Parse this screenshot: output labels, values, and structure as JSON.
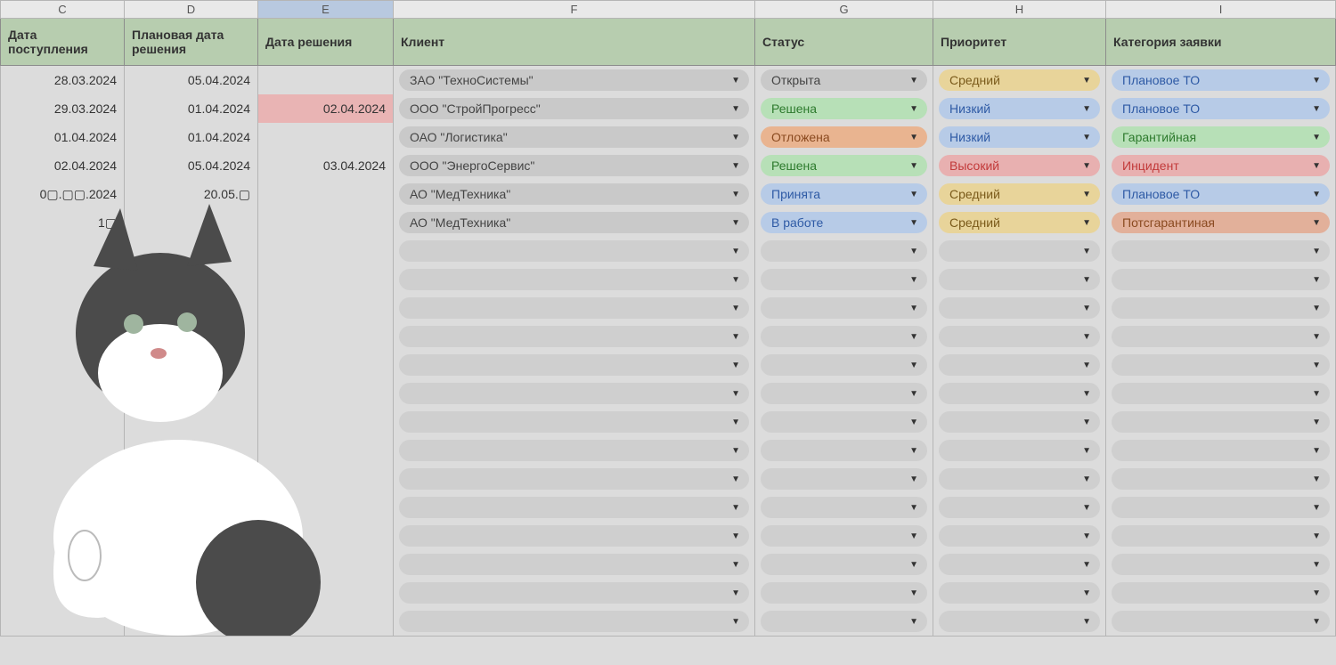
{
  "columns": [
    {
      "letter": "C",
      "header": "Дата поступления",
      "selected": false
    },
    {
      "letter": "D",
      "header": "Плановая дата решения",
      "selected": false
    },
    {
      "letter": "E",
      "header": "Дата решения",
      "selected": true
    },
    {
      "letter": "F",
      "header": "Клиент",
      "selected": false
    },
    {
      "letter": "G",
      "header": "Статус",
      "selected": false
    },
    {
      "letter": "H",
      "header": "Приоритет",
      "selected": false
    },
    {
      "letter": "I",
      "header": "Категория заявки",
      "selected": false
    }
  ],
  "status_colors": {
    "Открыта": "pill-gray",
    "Решена": "pill-green",
    "Отложена": "pill-orange",
    "Принята": "pill-blue",
    "В работе": "pill-blue"
  },
  "priority_colors": {
    "Средний": "pill-yellow",
    "Низкий": "pill-blue",
    "Высокий": "pill-red"
  },
  "category_colors": {
    "Плановое ТО": "pill-blue",
    "Гарантийная": "pill-green",
    "Инцидент": "pill-red",
    "Потсгарантиная": "pill-brown"
  },
  "rows": [
    {
      "date_in": "28.03.2024",
      "date_plan": "05.04.2024",
      "date_res": "",
      "res_late": false,
      "client": "ЗАО \"ТехноСистемы\"",
      "status": "Открыта",
      "priority": "Средний",
      "category": "Плановое ТО"
    },
    {
      "date_in": "29.03.2024",
      "date_plan": "01.04.2024",
      "date_res": "02.04.2024",
      "res_late": true,
      "client": "ООО \"СтройПрогресс\"",
      "status": "Решена",
      "priority": "Низкий",
      "category": "Плановое ТО"
    },
    {
      "date_in": "01.04.2024",
      "date_plan": "01.04.2024",
      "date_res": "",
      "res_late": false,
      "client": "ОАО \"Логистика\"",
      "status": "Отложена",
      "priority": "Низкий",
      "category": "Гарантийная"
    },
    {
      "date_in": "02.04.2024",
      "date_plan": "05.04.2024",
      "date_res": "03.04.2024",
      "res_late": false,
      "client": "ООО \"ЭнергоСервис\"",
      "status": "Решена",
      "priority": "Высокий",
      "category": "Инцидент"
    },
    {
      "date_in": "0▢.▢▢.2024",
      "date_plan": "20.05.▢",
      "date_res": "",
      "res_late": false,
      "client": "АО \"МедТехника\"",
      "status": "Принята",
      "priority": "Средний",
      "category": "Плановое ТО"
    },
    {
      "date_in": "1▢",
      "date_plan": "",
      "date_res": "",
      "res_late": false,
      "client": "АО \"МедТехника\"",
      "status": "В работе",
      "priority": "Средний",
      "category": "Потсгарантиная"
    }
  ],
  "empty_rows": 14,
  "overlay": {
    "name": "cat-thumbs-up",
    "description": "black-and-white cat giving thumbs up (meme overlay)"
  }
}
